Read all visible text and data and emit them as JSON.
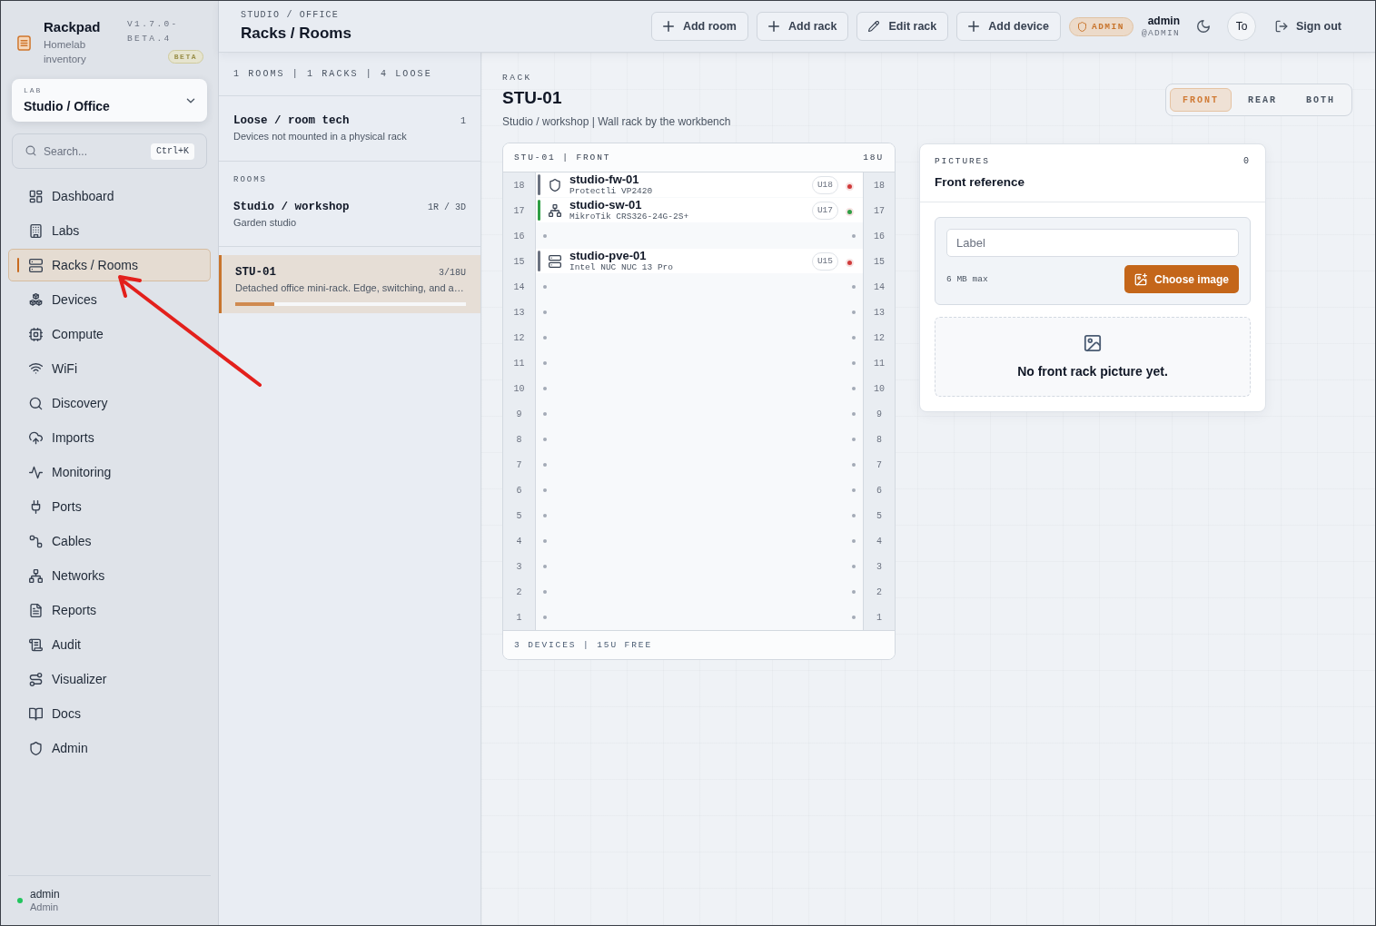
{
  "sidebar": {
    "brand": {
      "name": "Rackpad",
      "tagline": "Homelab inventory",
      "version": "V1.7.0-BETA.4",
      "badge": "BETA"
    },
    "lab_selector": {
      "label": "LAB",
      "value": "Studio / Office"
    },
    "search": {
      "placeholder": "Search...",
      "shortcut": "Ctrl+K"
    },
    "nav": [
      {
        "label": "Dashboard",
        "selected": false
      },
      {
        "label": "Labs",
        "selected": false
      },
      {
        "label": "Racks / Rooms",
        "selected": true
      },
      {
        "label": "Devices",
        "selected": false
      },
      {
        "label": "Compute",
        "selected": false
      },
      {
        "label": "WiFi",
        "selected": false
      },
      {
        "label": "Discovery",
        "selected": false
      },
      {
        "label": "Imports",
        "selected": false
      },
      {
        "label": "Monitoring",
        "selected": false
      },
      {
        "label": "Ports",
        "selected": false
      },
      {
        "label": "Cables",
        "selected": false
      },
      {
        "label": "Networks",
        "selected": false
      },
      {
        "label": "Reports",
        "selected": false
      },
      {
        "label": "Audit",
        "selected": false
      },
      {
        "label": "Visualizer",
        "selected": false
      },
      {
        "label": "Docs",
        "selected": false
      },
      {
        "label": "Admin",
        "selected": false
      }
    ],
    "user": {
      "name": "admin",
      "role": "Admin",
      "online": true
    }
  },
  "header": {
    "breadcrumb": "STUDIO / OFFICE",
    "title": "Racks / Rooms",
    "actions": [
      {
        "label": "Add room",
        "kind": "add"
      },
      {
        "label": "Add rack",
        "kind": "add"
      },
      {
        "label": "Edit rack",
        "kind": "edit"
      },
      {
        "label": "Add device",
        "kind": "add"
      }
    ],
    "role_badge": "ADMIN",
    "user": {
      "name": "admin",
      "handle": "@ADMIN"
    },
    "avatar": "To",
    "sign_out": "Sign out"
  },
  "racks_panel": {
    "summary": "1 ROOMS | 1 RACKS | 4 LOOSE",
    "loose": {
      "title": "Loose / room tech",
      "count": "1",
      "description": "Devices not mounted in a physical rack"
    },
    "rooms_label": "ROOMS",
    "rooms": [
      {
        "title": "Studio / workshop",
        "count": "1R / 3D",
        "description": "Garden studio"
      }
    ],
    "racks": [
      {
        "title": "STU-01",
        "usage": "3/18U",
        "description": "Detached office mini-rack. Edge, switching, and a…",
        "level": 0.17,
        "selected": true
      }
    ]
  },
  "rack_detail": {
    "eyebrow": "RACK",
    "title": "STU-01",
    "subtitle": "Studio / workshop | Wall rack by the workbench",
    "views": [
      {
        "label": "FRONT",
        "selected": true
      },
      {
        "label": "REAR",
        "selected": false
      },
      {
        "label": "BOTH",
        "selected": false
      }
    ],
    "rack": {
      "heading": "STU-01 | FRONT",
      "size": "18U",
      "units": [
        {
          "left_number": "18",
          "right_number": "18",
          "kind": "device",
          "device": {
            "kind": "firewall",
            "name": "studio-fw-01",
            "model": "Protectli VP2420",
            "slot": "U18",
            "color": "#d03a3a",
            "edge": {
              "color": "#6b7280"
            }
          }
        },
        {
          "left_number": "17",
          "right_number": "17",
          "kind": "device",
          "device": {
            "kind": "switch",
            "name": "studio-sw-01",
            "model": "MikroTik CRS326-24G-2S+",
            "slot": "U17",
            "color": "#2f9e44",
            "edge": {
              "color": "#2f9e44"
            }
          }
        },
        {
          "left_number": "16",
          "right_number": "16",
          "kind": "empty"
        },
        {
          "left_number": "15",
          "right_number": "15",
          "kind": "device",
          "device": {
            "kind": "server",
            "name": "studio-pve-01",
            "model": "Intel NUC NUC 13 Pro",
            "slot": "U15",
            "color": "#d03a3a",
            "edge": {
              "color": "#6b7280"
            }
          }
        },
        {
          "left_number": "14",
          "right_number": "14",
          "kind": "empty"
        },
        {
          "left_number": "13",
          "right_number": "13",
          "kind": "empty"
        },
        {
          "left_number": "12",
          "right_number": "12",
          "kind": "empty"
        },
        {
          "left_number": "11",
          "right_number": "11",
          "kind": "empty"
        },
        {
          "left_number": "10",
          "right_number": "10",
          "kind": "empty"
        },
        {
          "left_number": "9",
          "right_number": "9",
          "kind": "empty"
        },
        {
          "left_number": "8",
          "right_number": "8",
          "kind": "empty"
        },
        {
          "left_number": "7",
          "right_number": "7",
          "kind": "empty"
        },
        {
          "left_number": "6",
          "right_number": "6",
          "kind": "empty"
        },
        {
          "left_number": "5",
          "right_number": "5",
          "kind": "empty"
        },
        {
          "left_number": "4",
          "right_number": "4",
          "kind": "empty"
        },
        {
          "left_number": "3",
          "right_number": "3",
          "kind": "empty"
        },
        {
          "left_number": "2",
          "right_number": "2",
          "kind": "empty"
        },
        {
          "left_number": "1",
          "right_number": "1",
          "kind": "empty"
        }
      ],
      "summary": "3 DEVICES | 15U FREE"
    },
    "pictures": {
      "eyebrow": "PICTURES",
      "count": "0",
      "title": "Front reference",
      "label_field": {
        "placeholder": "Label"
      },
      "size_hint": "6 MB max",
      "upload_button": "Choose image",
      "empty_message": "No front rack picture yet."
    }
  },
  "annotation": {
    "kind": "arrow"
  }
}
